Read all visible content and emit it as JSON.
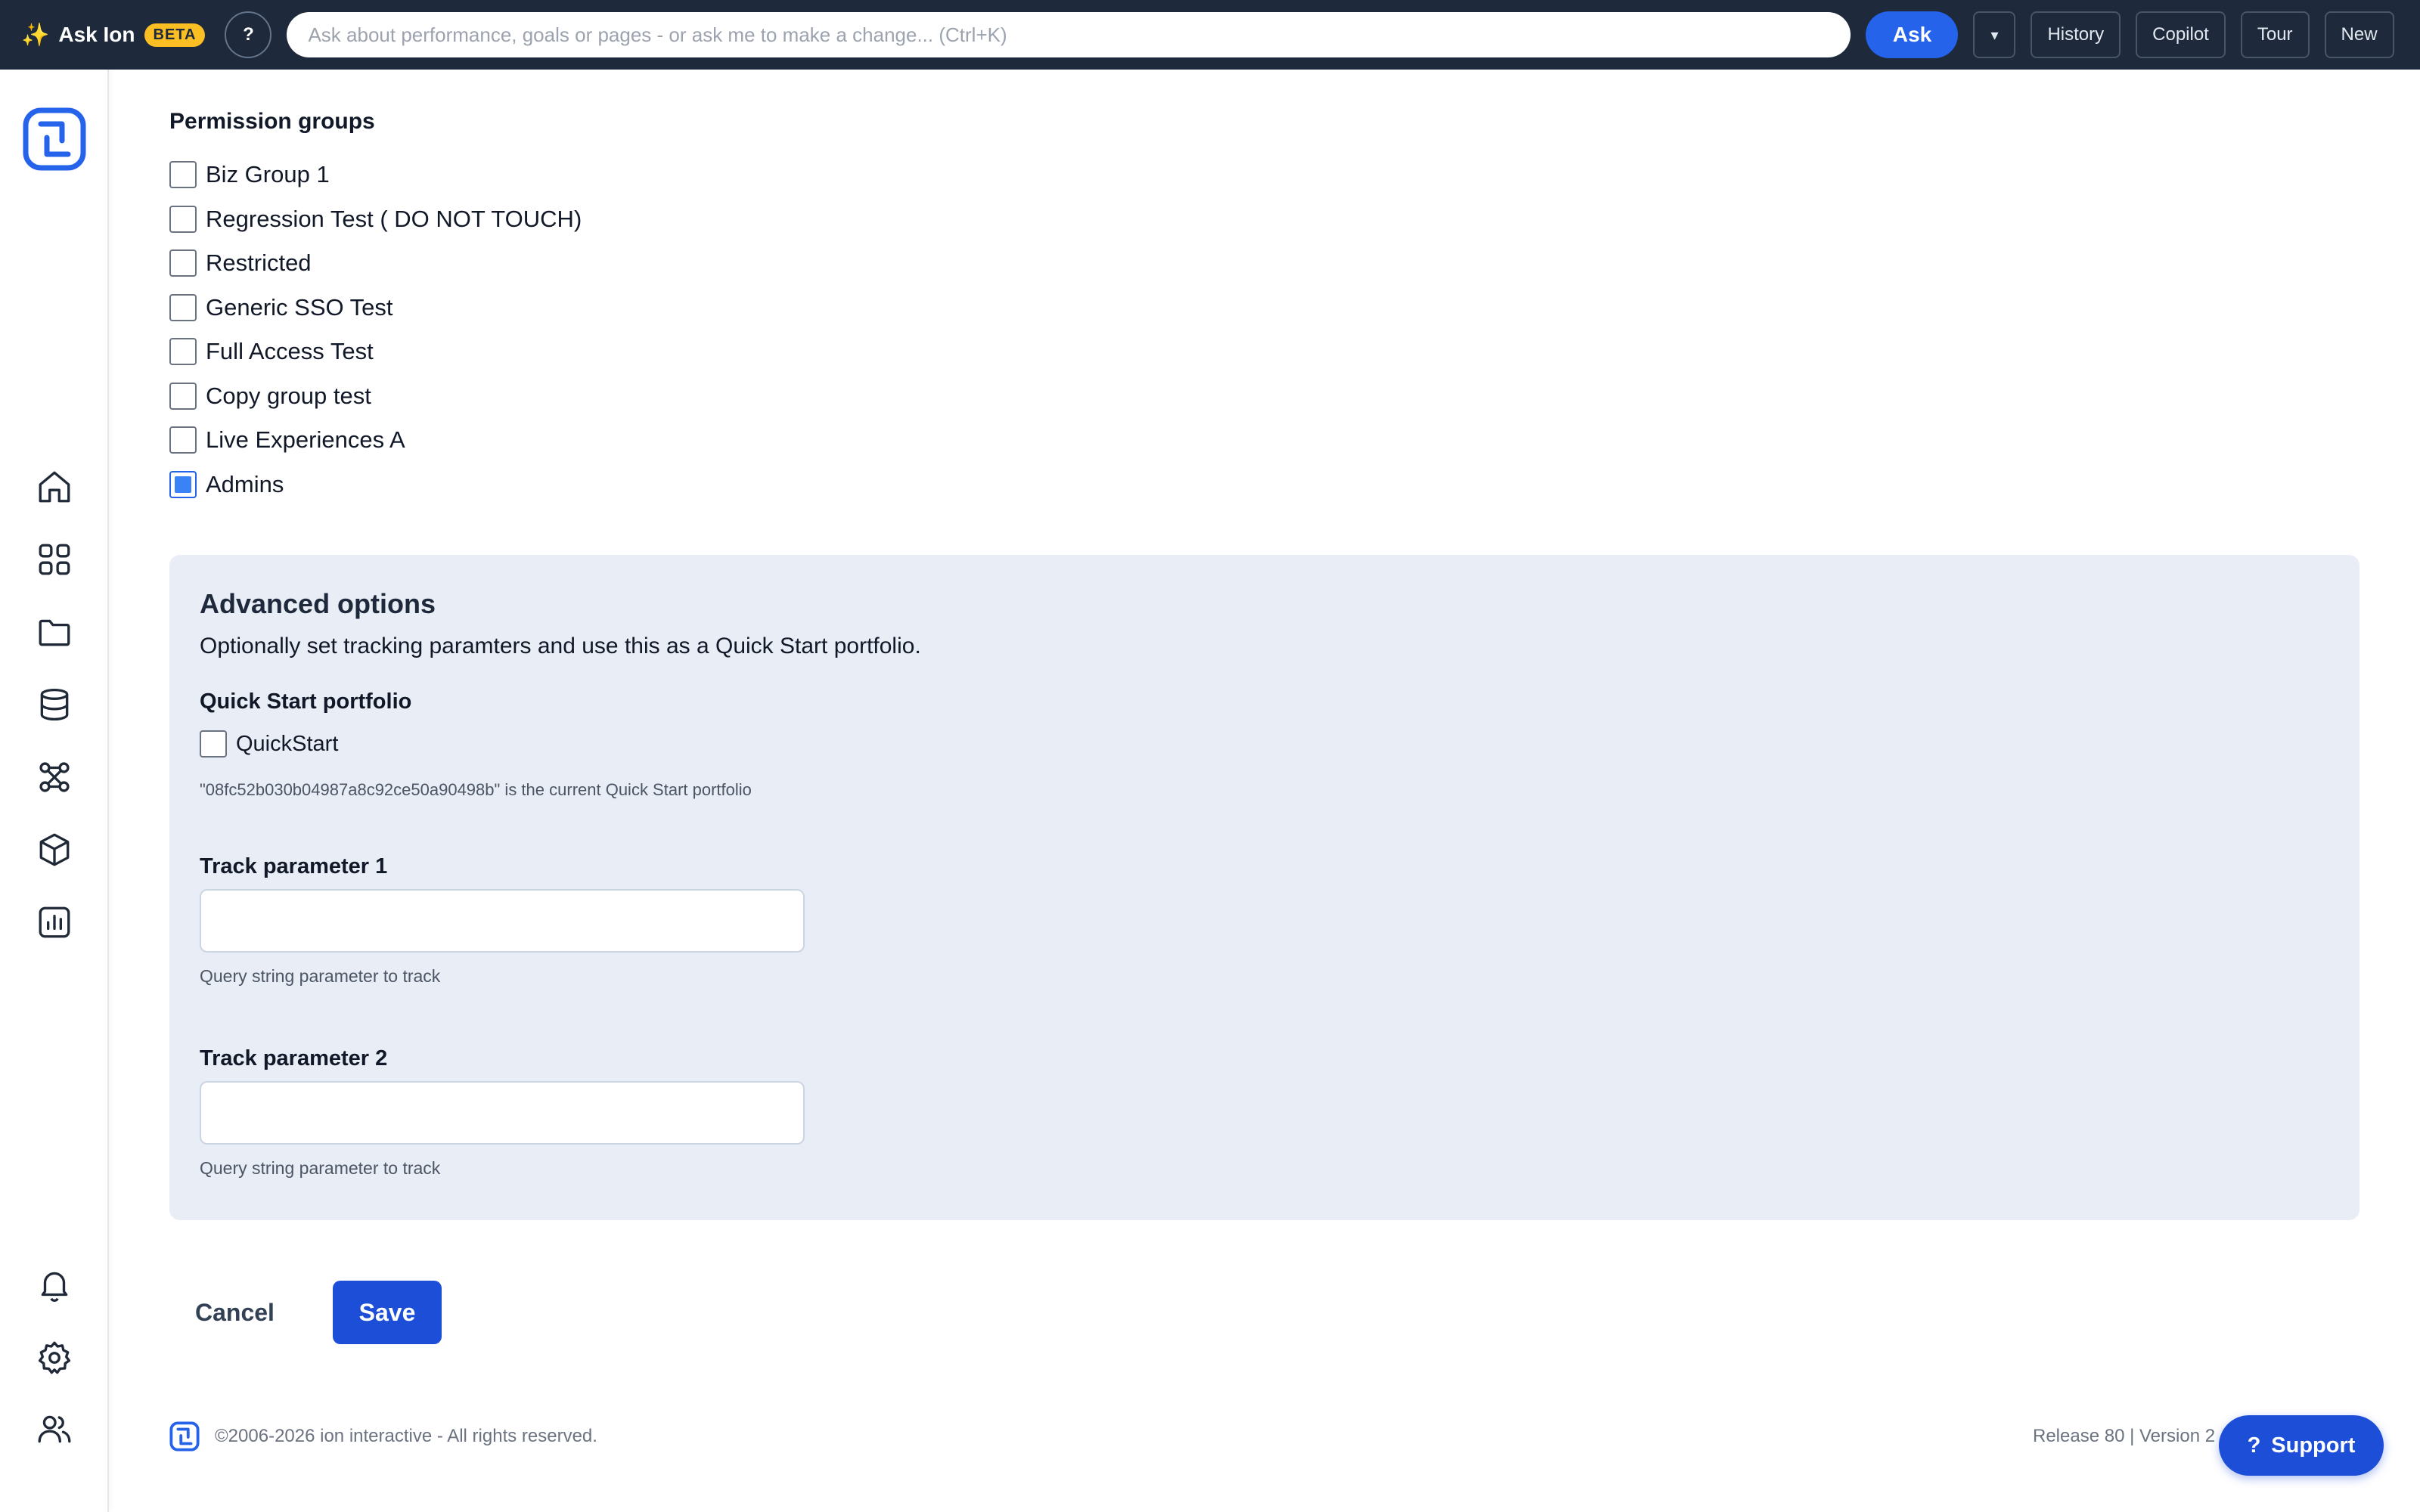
{
  "topbar": {
    "brand_icon": "sparkle-icon",
    "brand_label": "Ask Ion",
    "beta_badge": "BETA",
    "help_label": "?",
    "ask_placeholder": "Ask about performance, goals or pages - or ask me to make a change... (Ctrl+K)",
    "ask_button": "Ask",
    "dropdown_label": "▾",
    "history_button": "History",
    "copilot_button": "Copilot",
    "tour_button": "Tour",
    "new_button": "New"
  },
  "sidebar": {
    "icons": [
      "logo-icon",
      "home-icon",
      "apps-grid-icon",
      "folder-icon",
      "database-icon",
      "integrations-icon",
      "cube-icon",
      "analytics-icon",
      "bell-icon",
      "gear-icon",
      "users-icon"
    ]
  },
  "permissions": {
    "title": "Permission groups",
    "groups": [
      {
        "label": "Biz Group 1",
        "checked": false
      },
      {
        "label": "Regression Test ( DO NOT TOUCH)",
        "checked": false
      },
      {
        "label": "Restricted",
        "checked": false
      },
      {
        "label": "Generic SSO Test",
        "checked": false
      },
      {
        "label": "Full Access Test",
        "checked": false
      },
      {
        "label": "Copy group test",
        "checked": false
      },
      {
        "label": "Live Experiences A",
        "checked": false
      },
      {
        "label": "Admins",
        "checked": true
      }
    ]
  },
  "advanced": {
    "title": "Advanced options",
    "description": "Optionally set tracking paramters and use this as a Quick Start portfolio.",
    "quickstart_label": "Quick Start portfolio",
    "quickstart_checkbox": "QuickStart",
    "quickstart_checked": false,
    "quickstart_note": "\"08fc52b030b04987a8c92ce50a90498b\" is the current Quick Start portfolio",
    "track1_label": "Track parameter 1",
    "track1_value": "",
    "track1_help": "Query string parameter to track",
    "track2_label": "Track parameter 2",
    "track2_value": "",
    "track2_help": "Query string parameter to track"
  },
  "actions": {
    "cancel": "Cancel",
    "save": "Save"
  },
  "footer": {
    "copyright": "©2006-2026 ion interactive - All rights reserved.",
    "release": "Release 80 | Version 2",
    "support_icon": "?",
    "support_label": "Support"
  },
  "colors": {
    "topbar_bg": "#1e293b",
    "accent": "#2563eb",
    "beta_badge": "#fbbf24",
    "panel_bg": "#e9edf6"
  }
}
